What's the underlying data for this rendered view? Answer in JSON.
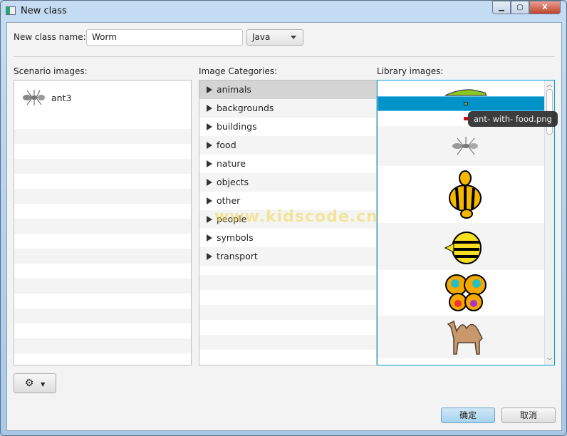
{
  "window": {
    "title": "New class"
  },
  "form": {
    "class_name_label": "New class name:",
    "class_name_value": "Worm",
    "language": "Java"
  },
  "scenario": {
    "label": "Scenario images:",
    "items": [
      {
        "name": "ant3"
      }
    ]
  },
  "categories": {
    "label": "Image Categories:",
    "items": [
      "animals",
      "backgrounds",
      "buildings",
      "food",
      "nature",
      "objects",
      "other",
      "people",
      "symbols",
      "transport"
    ],
    "selected": "animals"
  },
  "library": {
    "label": "Library images:",
    "tooltip": "ant- with- food.png",
    "images": [
      "alligator",
      "ant-with-food",
      "ant-red",
      "ant",
      "bee",
      "bee2",
      "butterfly",
      "camel"
    ]
  },
  "watermark": "www.kidscode.cn",
  "buttons": {
    "ok": "确定",
    "cancel": "取消"
  },
  "colors": {
    "selection": "#0093c9",
    "accent_border": "#039ed3"
  }
}
